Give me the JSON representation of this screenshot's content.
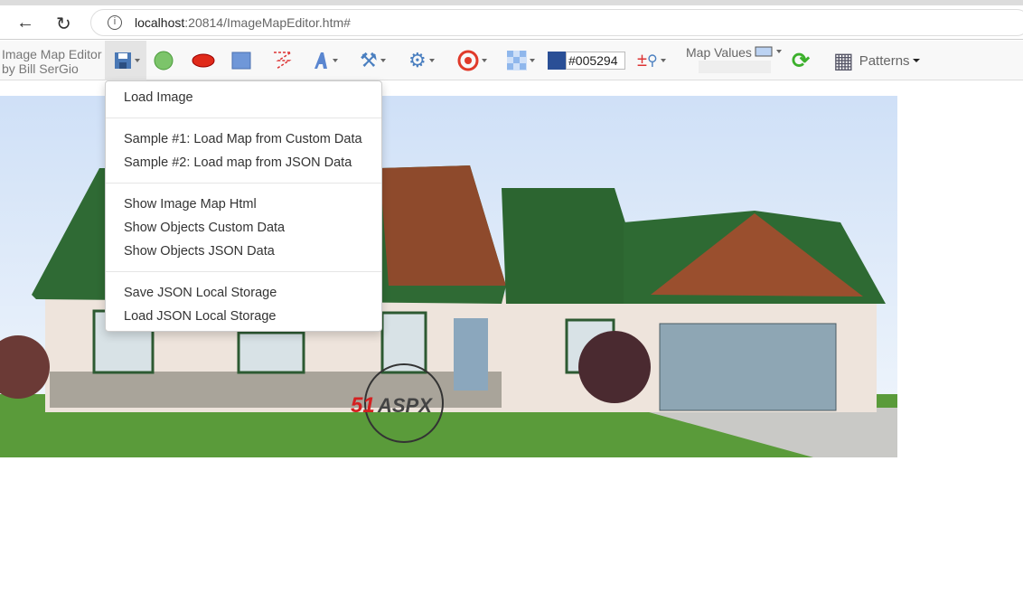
{
  "browser": {
    "url_host": "localhost",
    "url_rest": ":20814/ImageMapEditor.htm#"
  },
  "toolbar": {
    "brand_line1": "Image Map Editor",
    "brand_line2": "by Bill SerGio",
    "color_value": "#005294",
    "map_values_label": "Map Values",
    "patterns_label": "Patterns",
    "accent": "#2a4f96"
  },
  "menu": {
    "items": [
      "Load Image",
      "Sample #1: Load Map from Custom Data",
      "Sample #2: Load map from JSON Data",
      "Show Image Map Html",
      "Show Objects Custom Data",
      "Show Objects JSON Data",
      "Save JSON Local Storage",
      "Load JSON Local Storage"
    ]
  },
  "image": {
    "watermark": "51ASPX"
  }
}
